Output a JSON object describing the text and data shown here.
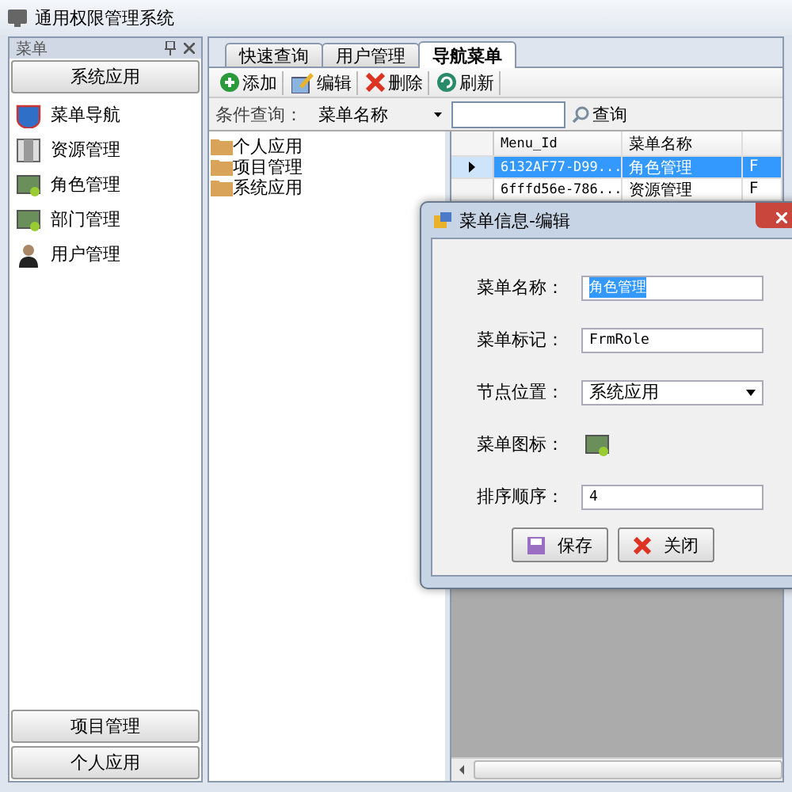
{
  "window": {
    "title": "通用权限管理系统"
  },
  "sidebar": {
    "title": "菜单",
    "sections": [
      {
        "label": "系统应用",
        "items": [
          "菜单导航",
          "资源管理",
          "角色管理",
          "部门管理",
          "用户管理"
        ]
      },
      {
        "label": "项目管理"
      },
      {
        "label": "个人应用"
      }
    ]
  },
  "tabs": [
    {
      "label": "快速查询",
      "selected": false
    },
    {
      "label": "用户管理",
      "selected": false
    },
    {
      "label": "导航菜单",
      "selected": true
    }
  ],
  "toolbar": [
    "添加",
    "编辑",
    "删除",
    "刷新"
  ],
  "filter": {
    "label": "条件查询：",
    "field": "菜单名称",
    "search_button": "查询"
  },
  "tree": [
    "个人应用",
    "项目管理",
    "系统应用"
  ],
  "grid": {
    "columns": [
      "Menu_Id",
      "菜单名称"
    ],
    "rows": [
      {
        "cells": [
          "6132AF77-D99...",
          "角色管理",
          "F"
        ],
        "selected": true
      },
      {
        "cells": [
          "6fffd56e-786...",
          "资源管理",
          "F"
        ],
        "selected": false
      }
    ]
  },
  "dialog": {
    "title": "菜单信息-编辑",
    "fields": [
      {
        "kind": "text",
        "label": "菜单名称：",
        "value": "角色管理",
        "highlighted": true
      },
      {
        "kind": "text",
        "label": "菜单标记：",
        "value": "FrmRole",
        "highlighted": false
      },
      {
        "kind": "select",
        "label": "节点位置：",
        "value": "系统应用"
      },
      {
        "kind": "icon",
        "label": "菜单图标："
      },
      {
        "kind": "text",
        "label": "排序顺序：",
        "value": "4",
        "highlighted": false
      }
    ],
    "buttons": [
      "保存",
      "关闭"
    ]
  }
}
